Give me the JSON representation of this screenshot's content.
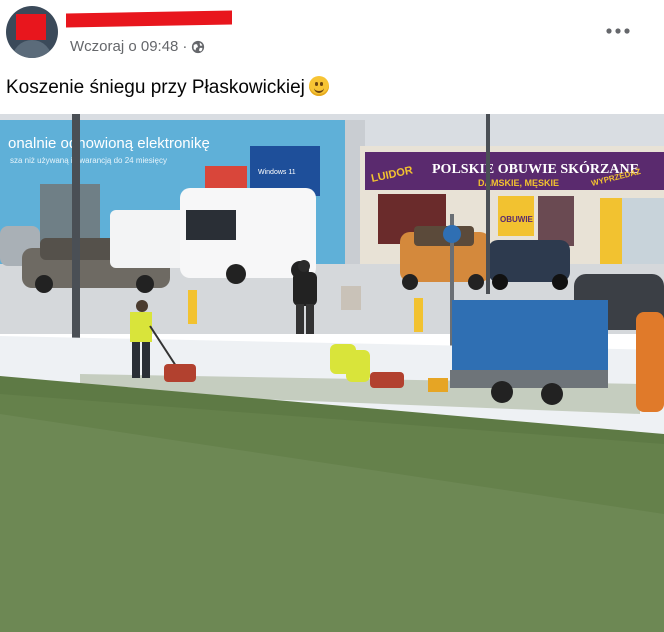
{
  "post": {
    "author_name": "Redacted name",
    "timestamp": "Wczoraj o 09:48",
    "separator": "·",
    "privacy_icon": "globe-icon",
    "more_icon": "more-options-icon",
    "text": "Koszenie śniegu przy Płaskowickiej",
    "emoji": "smiling-face-emoji"
  },
  "photo": {
    "billboard_line1": "onalnie odnowioną elektronikę",
    "billboard_line2": "sza niż używaną i gwarancją do 24 miesięcy",
    "billboard_screen": "Windows 11",
    "shop_brand": "LUIDOR",
    "shop_title": "POLSKIE OBUWIE SKÓRZANE",
    "shop_subtitle": "DAMSKIE, MĘSKIE",
    "shop_badge": "WYPRZEDAŻ",
    "shop_window_sign": "OBUWIE",
    "colors": {
      "sky": "#d9dde2",
      "grass": "#5e7a45",
      "snow": "#eef1f4",
      "banner": "#5a2a6e",
      "billboard": "#5fb0d8",
      "tarp": "#2f6fb3"
    }
  }
}
